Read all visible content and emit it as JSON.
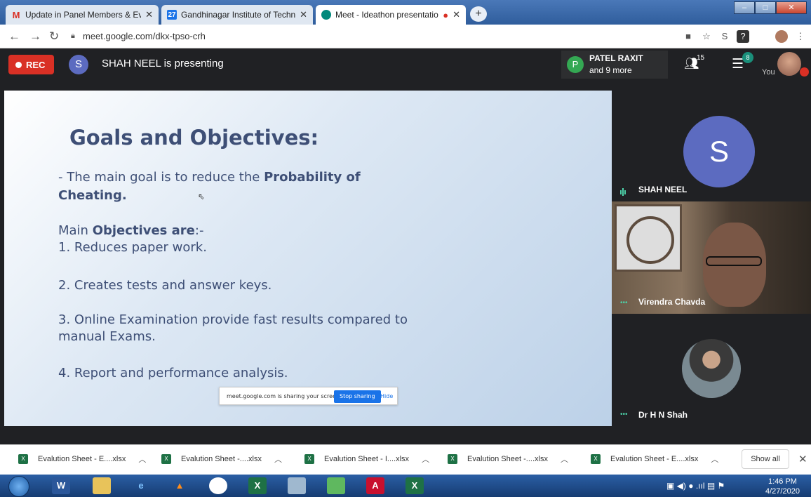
{
  "browser": {
    "tabs": [
      {
        "title": "Update in Panel Members & Eval",
        "icon": "gmail-icon"
      },
      {
        "title": "Gandhinagar Institute of Technol",
        "icon": "calendar-icon"
      },
      {
        "title": "Meet - Ideathon presentatio",
        "icon": "meet-icon",
        "active": true
      }
    ],
    "url": "meet.google.com/dkx-tpso-crh"
  },
  "meet": {
    "rec_label": "REC",
    "presenter_initial": "S",
    "presenting_text": "SHAH NEEL is presenting",
    "participant_initial": "P",
    "participant_name": "PATEL RAXIT",
    "participant_more": "and 9 more",
    "people_count": "15",
    "chat_badge": "8",
    "self_label": "You"
  },
  "slide": {
    "title": "Goals and Objectives:",
    "goal_prefix": "- The main goal is to reduce the ",
    "goal_bold": "Probability of",
    "goal_bold2": "Cheating.",
    "objectives_prefix": "Main ",
    "objectives_bold": "Objectives are",
    "objectives_suffix": ":-",
    "items": [
      "1. Reduces paper work.",
      "2. Creates tests and answer keys.",
      "3. Online Examination provide fast results compared to",
      "manual Exams.",
      "4. Report and performance analysis."
    ]
  },
  "share_bar": {
    "message": "meet.google.com is sharing your screen.",
    "stop_label": "Stop sharing",
    "hide_label": "Hide"
  },
  "tiles": {
    "main_initial": "S",
    "main_name": "SHAH NEEL",
    "video_name": "Virendra Chavda",
    "third_name": "Dr H N Shah"
  },
  "downloads": {
    "items": [
      "Evalution Sheet - E....xlsx",
      "Evalution Sheet -....xlsx",
      "Evalution Sheet - I....xlsx",
      "Evalution Sheet -....xlsx",
      "Evalution Sheet - E....xlsx"
    ],
    "show_all": "Show all"
  },
  "taskbar": {
    "time": "1:46 PM",
    "date": "4/27/2020"
  },
  "colors": {
    "meet_bg": "#202124",
    "rec_red": "#d93025",
    "slide_text": "#3e4f76",
    "accent_blue": "#1a73e8"
  }
}
